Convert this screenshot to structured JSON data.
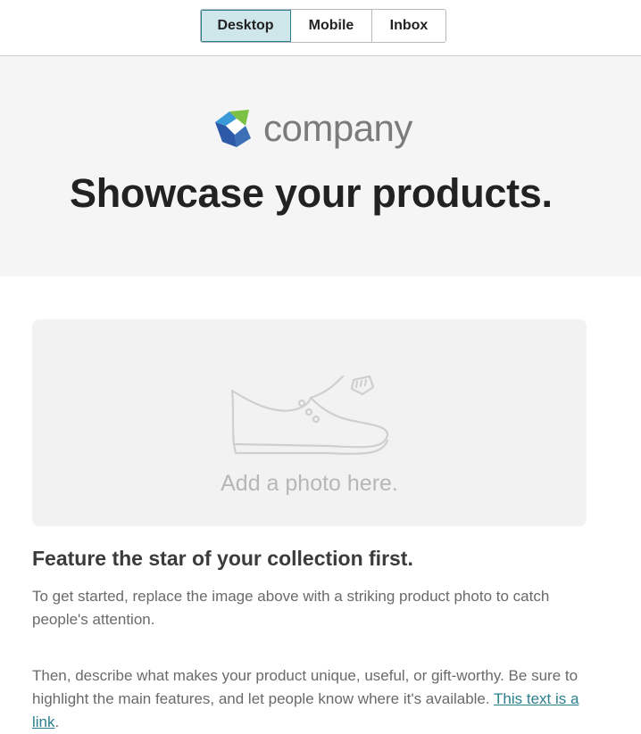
{
  "view_tabs": [
    {
      "label": "Desktop",
      "active": true
    },
    {
      "label": "Mobile",
      "active": false
    },
    {
      "label": "Inbox",
      "active": false
    }
  ],
  "header": {
    "logo_text": "company",
    "logo_icon": "company-logo-icon",
    "headline": "Showcase your products."
  },
  "photo_placeholder": {
    "icon": "shoe-icon",
    "text": "Add a photo here."
  },
  "content": {
    "title": "Feature the star of your collection first.",
    "paragraph1": "To get started, replace the image above with a striking product photo to catch people's attention.",
    "paragraph2_text": "Then, describe what makes your product unique, useful, or gift-worthy. Be sure to highlight the main features, and let people know where it's available. ",
    "link_text": "This text is a link",
    "paragraph2_end": "."
  },
  "colors": {
    "accent": "#2b7f8e",
    "active_tab_bg": "#cfe6ea",
    "header_bg": "#f5f5f5",
    "placeholder_bg": "#f2f2f2"
  }
}
